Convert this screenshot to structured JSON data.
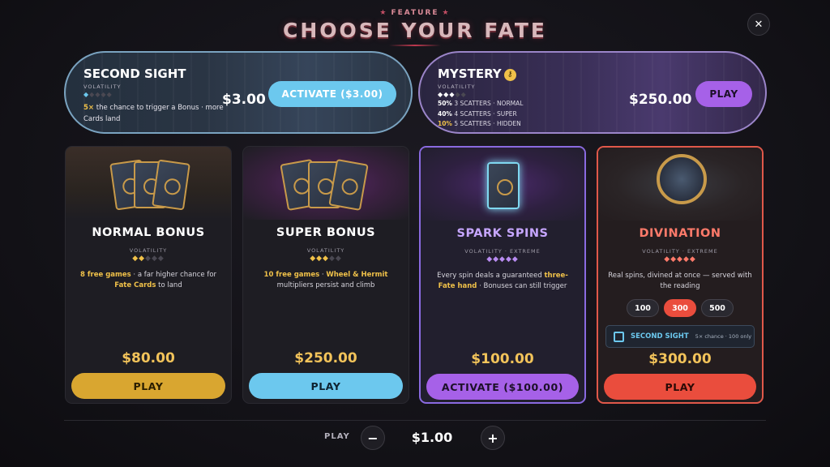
{
  "header": {
    "eyebrow": "FEATURE",
    "title": "CHOOSE YOUR FATE",
    "close_icon": "close-icon"
  },
  "second_sight": {
    "name": "SECOND SIGHT",
    "volatility_label": "VOLATILITY",
    "volatility_level": 1,
    "volatility_max": 5,
    "desc_highlight": "5×",
    "desc_rest": " the chance to trigger a Bonus · more Cards land",
    "price": "$3.00",
    "button": "ACTIVATE ($3.00)"
  },
  "mystery": {
    "name": "MYSTERY",
    "lock_icon": "lock-icon",
    "volatility_label": "VOLATILITY",
    "volatility_level": 3,
    "odds": [
      {
        "pct": "50%",
        "text": "3 SCATTERS · NORMAL"
      },
      {
        "pct": "40%",
        "text": "4 SCATTERS · SUPER"
      },
      {
        "pct": "10%",
        "text": "5 SCATTERS · HIDDEN"
      }
    ],
    "price": "$250.00",
    "button": "PLAY"
  },
  "cards": [
    {
      "name": "NORMAL BONUS",
      "volatility_label": "VOLATILITY",
      "volatility_level": 2,
      "volatility_max": 5,
      "desc_a": "8 free games",
      "desc_b": " · a far higher chance for ",
      "desc_c": "Fate Cards",
      "desc_d": " to land",
      "price": "$80.00",
      "button": "PLAY"
    },
    {
      "name": "SUPER BONUS",
      "volatility_label": "VOLATILITY",
      "volatility_level": 3,
      "volatility_max": 5,
      "desc_a": "10 free games",
      "desc_b": " · ",
      "desc_c": "Wheel & Hermit",
      "desc_d": " multipliers persist and climb",
      "price": "$250.00",
      "button": "PLAY"
    },
    {
      "name": "SPARK SPINS",
      "volatility_label": "VOLATILITY · EXTREME",
      "volatility_level": 5,
      "volatility_max": 5,
      "desc_a": "Every spin deals a guaranteed ",
      "desc_b": "three-Fate hand",
      "desc_c": " · Bonuses can still trigger",
      "price": "$100.00",
      "button": "ACTIVATE ($100.00)"
    },
    {
      "name": "DIVINATION",
      "volatility_label": "VOLATILITY · EXTREME",
      "volatility_level": 5,
      "volatility_max": 5,
      "desc": "Real spins, divined at once — served with the reading",
      "qty_options": [
        "100",
        "300",
        "500"
      ],
      "qty_selected": "300",
      "second_sight_label": "SECOND SIGHT",
      "second_sight_sub": "5× chance · 100 only",
      "price": "$300.00",
      "button": "PLAY"
    }
  ],
  "bet": {
    "label": "PLAY",
    "minus": "−",
    "value": "$1.00",
    "plus": "+"
  },
  "colors": {
    "gold": "#f0c149",
    "sky": "#6cc8ee",
    "purple": "#a661e8",
    "red": "#ea4d3d"
  }
}
